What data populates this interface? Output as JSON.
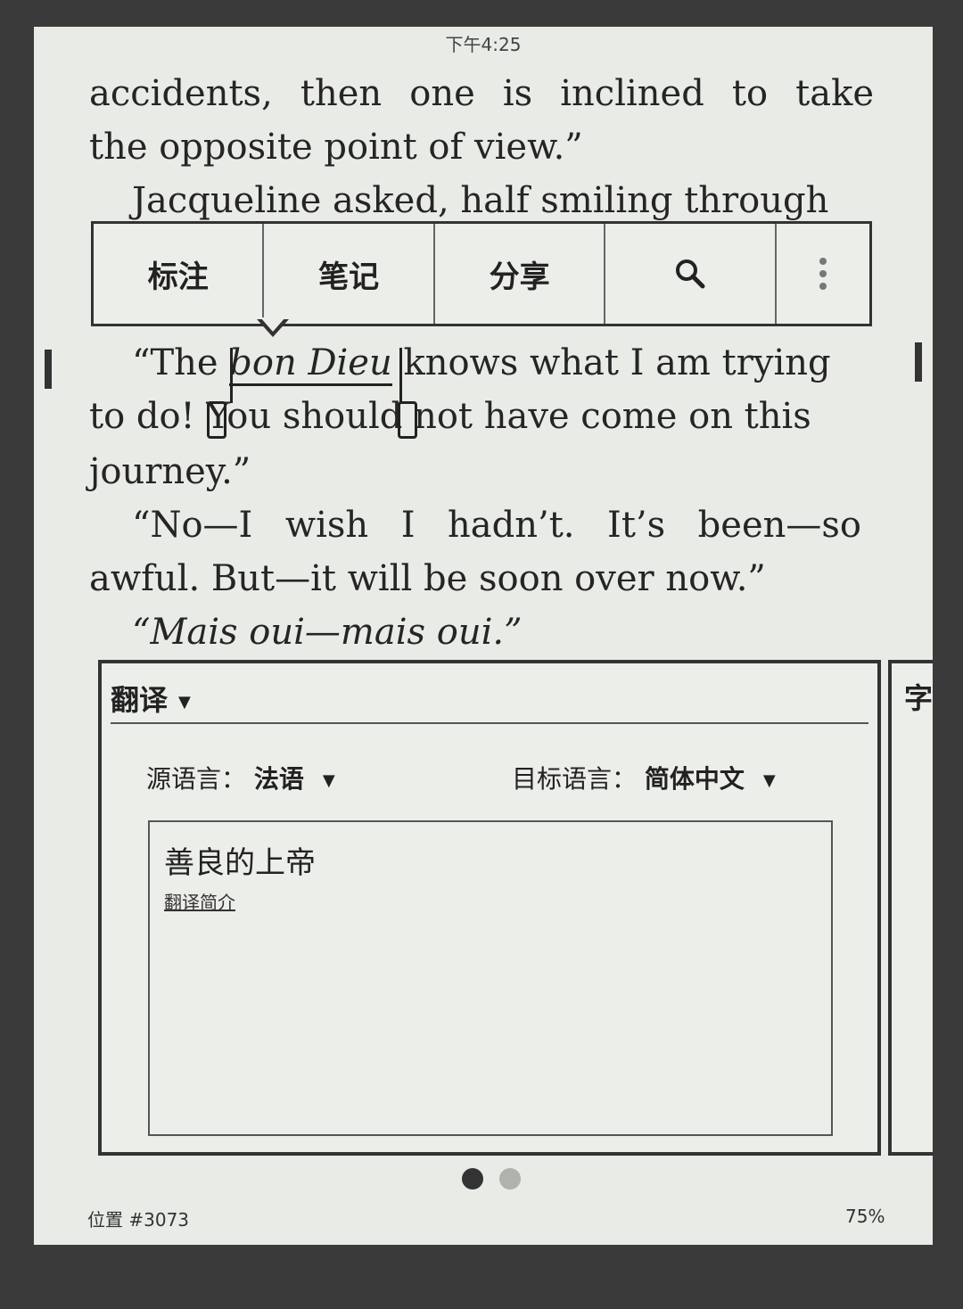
{
  "status": {
    "time": "下午4:25"
  },
  "book": {
    "line1": "accidents, then one is inclined to take",
    "line2": "the opposite point of view.”",
    "line3": "Jacqueline asked, half smiling through",
    "line5a": "“The",
    "line5b": "bon Dieu",
    "line5c": "knows what I am trying",
    "line6": "to do! You should not have come on this",
    "line7": "journey.”",
    "line8": "“No—I wish I hadn’t. It’s been—so",
    "line9": "awful. But—it will be soon over now.”",
    "line10": "“Mais oui—mais oui.”"
  },
  "toolbar": {
    "highlight_label": "标注",
    "note_label": "笔记",
    "share_label": "分享",
    "search_icon": "search-icon",
    "more_icon": "more-vertical-icon"
  },
  "translate_panel": {
    "title": "翻译",
    "source_label": "源语言：",
    "source_value": "法语",
    "target_label": "目标语言：",
    "target_value": "简体中文",
    "result": "善良的上帝",
    "link": "翻译简介",
    "next_panel_peek": "字"
  },
  "pager": {
    "active": 1,
    "count": 2
  },
  "footer": {
    "location": "位置 #3073",
    "progress": "75%"
  }
}
